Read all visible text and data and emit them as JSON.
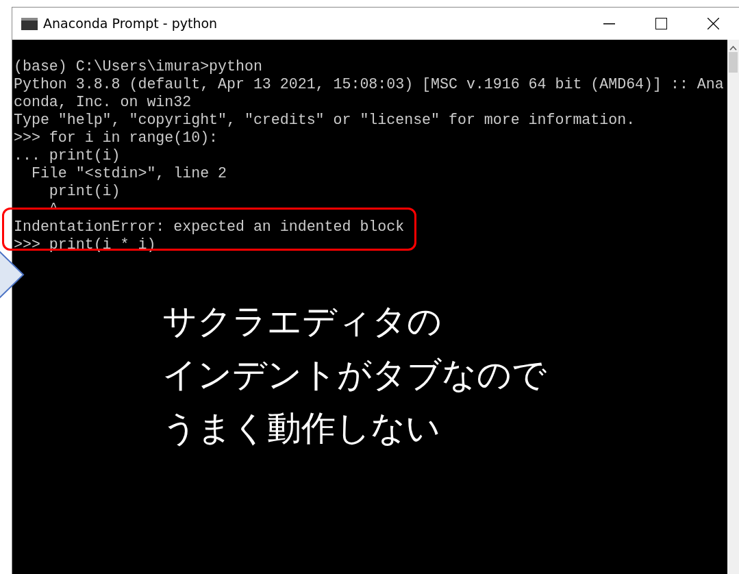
{
  "window": {
    "title": "Anaconda Prompt - python"
  },
  "console": {
    "lines": [
      "(base) C:\\Users\\imura>python",
      "Python 3.8.8 (default, Apr 13 2021, 15:08:03) [MSC v.1916 64 bit (AMD64)] :: Ana",
      "conda, Inc. on win32",
      "Type \"help\", \"copyright\", \"credits\" or \"license\" for more information.",
      ">>> for i in range(10):",
      "... print(i)",
      "  File \"<stdin>\", line 2",
      "    print(i)",
      "    ^",
      "IndentationError: expected an indented block",
      ">>> print(i * i)"
    ]
  },
  "annotation": {
    "lines": [
      "サクラエディタの",
      "インデントがタブなので",
      "うまく動作しない"
    ]
  }
}
